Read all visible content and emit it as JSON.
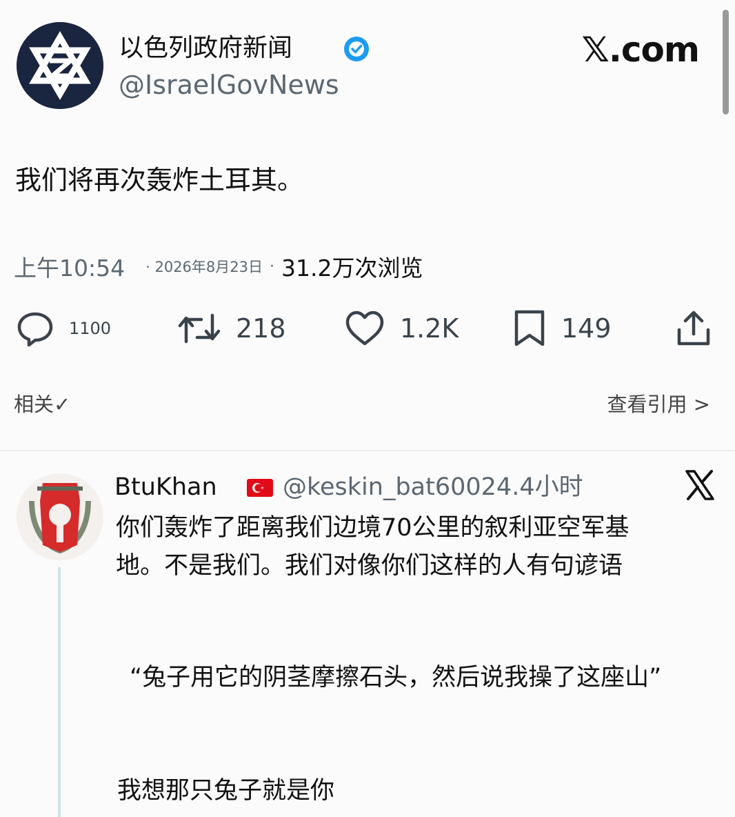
{
  "header": {
    "display_name": "以色列政府新闻",
    "handle": "@IsraelGovNews",
    "brand": "𝕏.com"
  },
  "post": {
    "text": "我们将再次轰炸土耳其。",
    "time": "上午10:54",
    "date": "2026年8月23日",
    "views": "31.2万次浏览"
  },
  "actions": {
    "replies": "1100",
    "reposts": "218",
    "likes": "1.2K",
    "bookmarks": "149"
  },
  "links": {
    "related": "相关✓",
    "quotes": "查看引用 >"
  },
  "reply": {
    "name": "BtuKhan",
    "handle_time": "@keskin_bat60024.4小时",
    "body": "你们轰炸了距离我们边境70公里的叙利亚空军基地。不是我们。我们对像你们这样的人有句谚语",
    "quote": "“兔子用它的阴茎摩擦石头，然后说我操了这座山”",
    "last": "我想那只兔子就是你"
  },
  "colors": {
    "accent_verified": "#1d9bf0",
    "avatar_bg": "#1a2540",
    "flag_red": "#e30a17"
  },
  "icons": [
    "reply-icon",
    "repost-icon",
    "like-icon",
    "bookmark-icon",
    "share-icon",
    "verified-badge-icon",
    "x-logo-icon",
    "turkey-flag-icon"
  ]
}
